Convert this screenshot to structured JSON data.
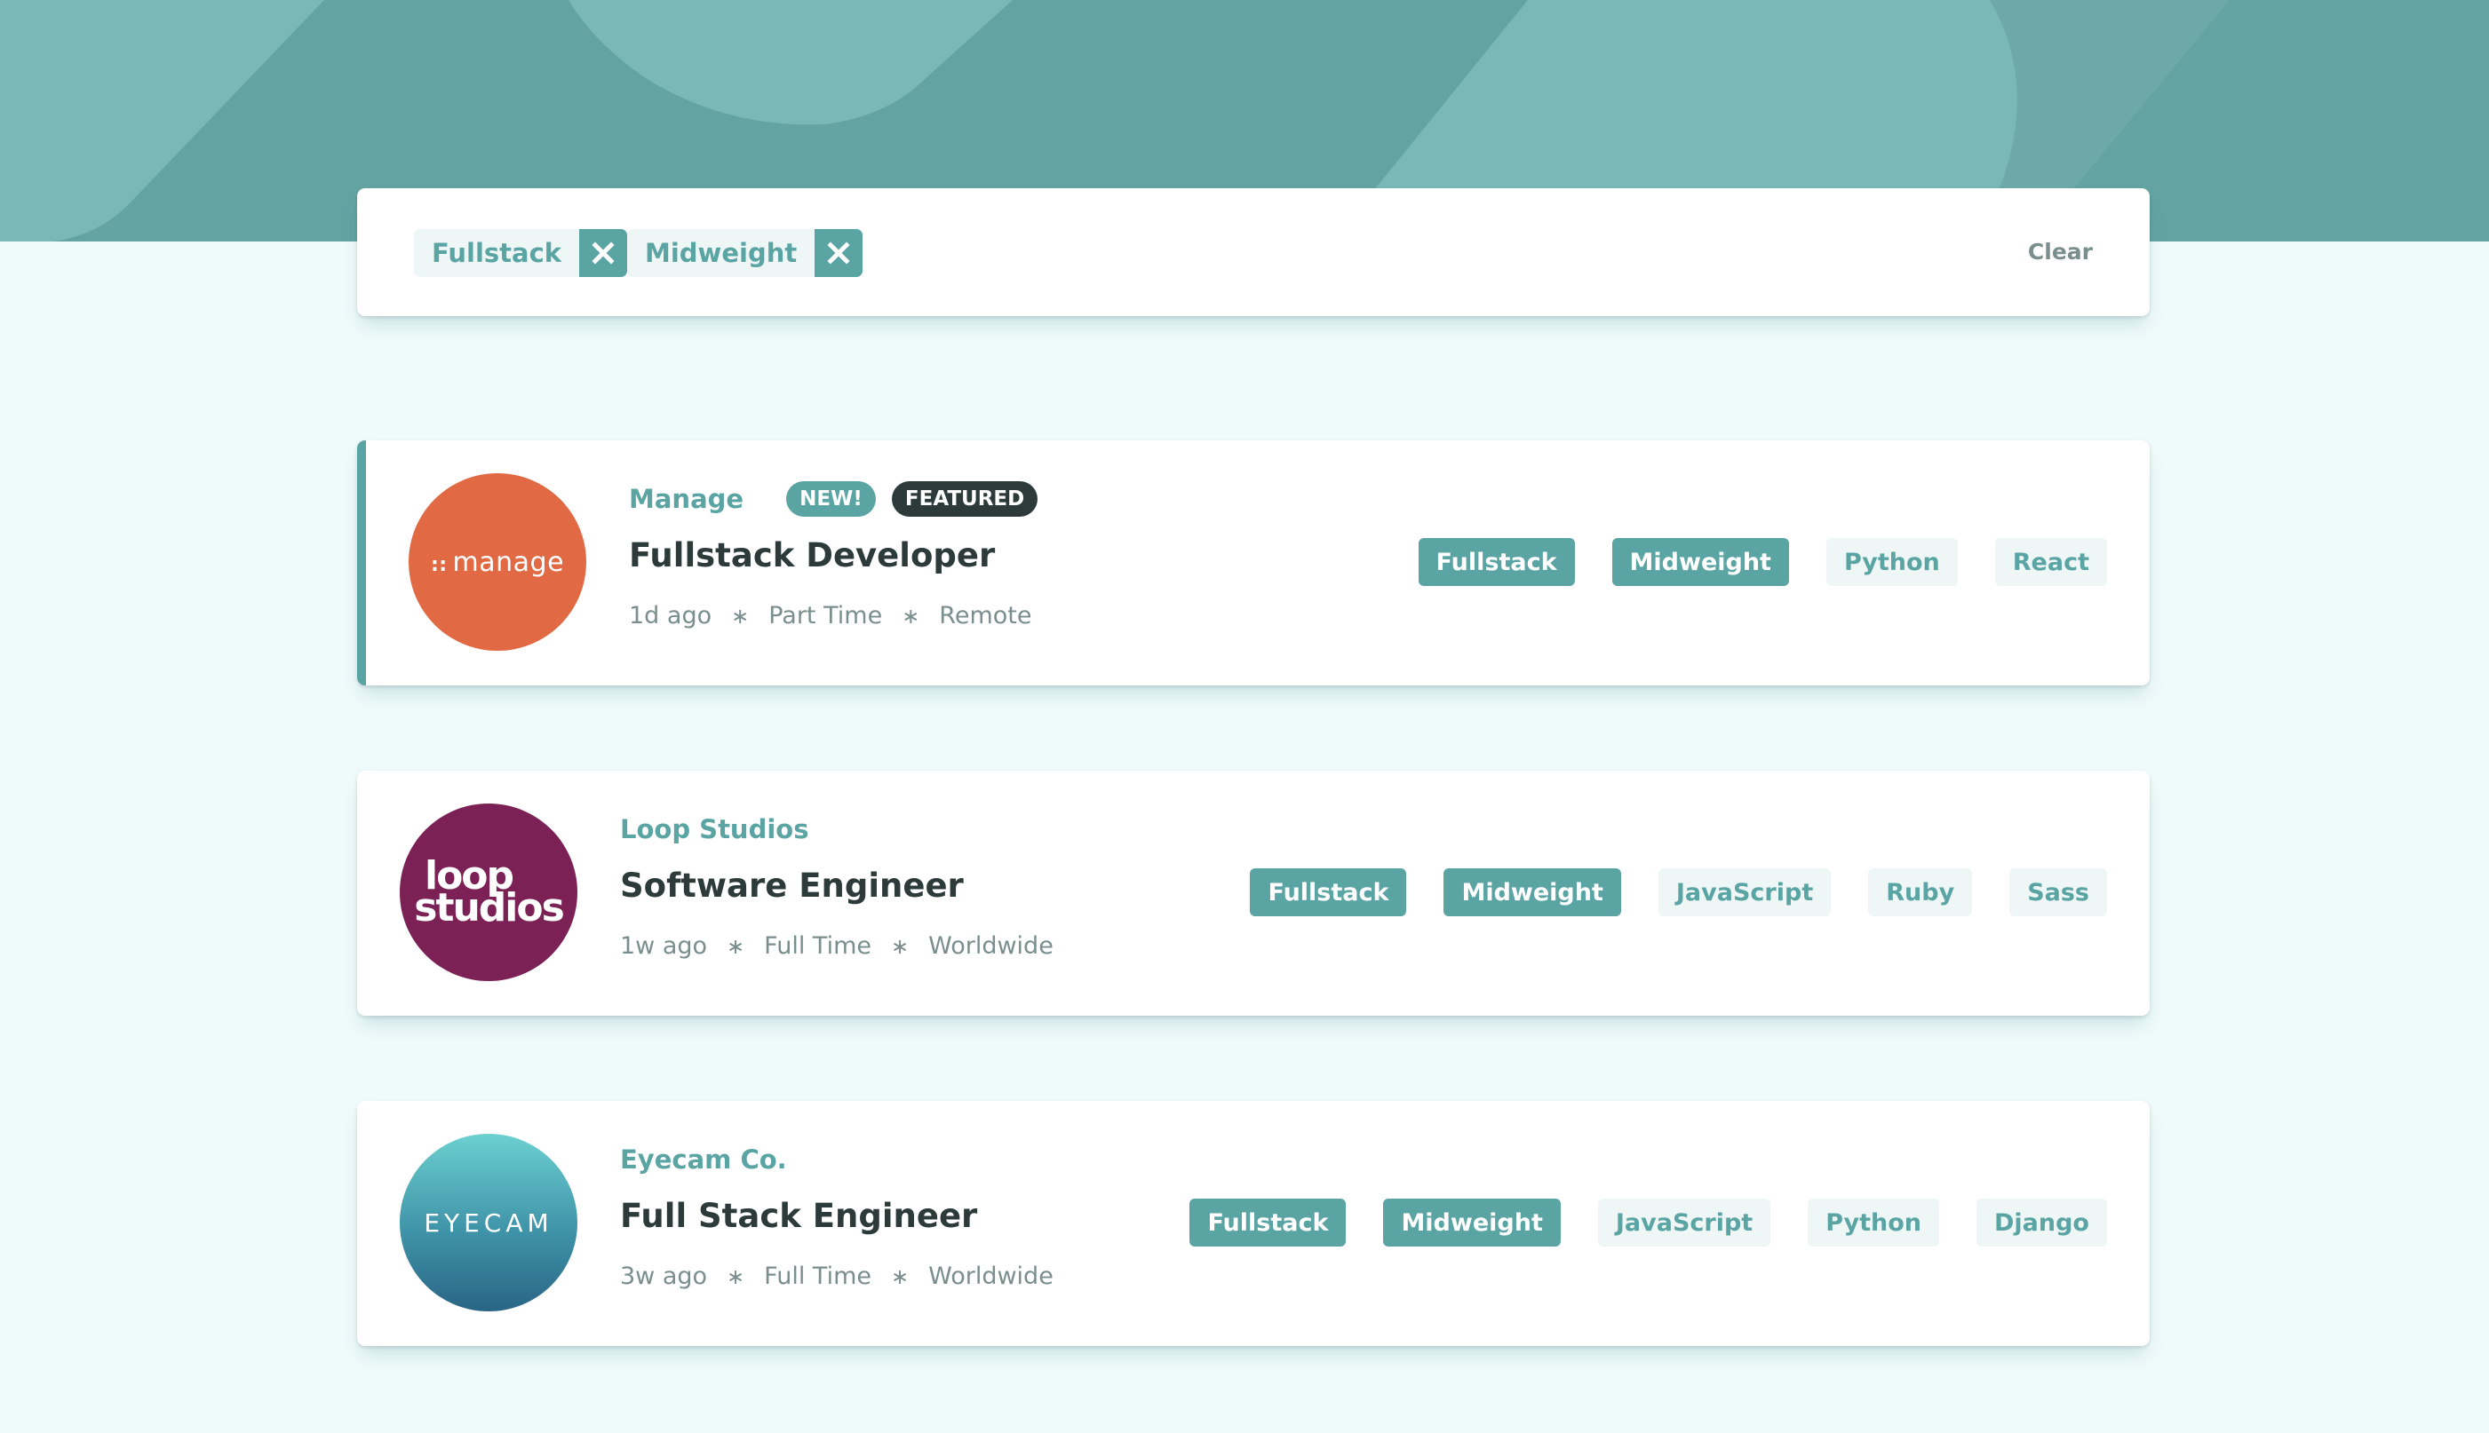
{
  "colors": {
    "primary": "#5ba4a4",
    "background": "#effafa",
    "tag_background": "#eef6f6",
    "dark": "#2c3a3a",
    "gray": "#7b8e8e"
  },
  "filters": {
    "chips": [
      {
        "label": "Fullstack",
        "icon": "close-icon"
      },
      {
        "label": "Midweight",
        "icon": "close-icon"
      }
    ],
    "clear_label": "Clear"
  },
  "jobs": [
    {
      "logo_text": "manage",
      "logo_prefix": "::",
      "company": "Manage",
      "new_label": "NEW!",
      "featured_label": "FEATURED",
      "position": "Fullstack Developer",
      "posted": "1d ago",
      "contract": "Part Time",
      "location": "Remote",
      "tags": [
        "Fullstack",
        "Midweight",
        "Python",
        "React"
      ]
    },
    {
      "logo_line1": "loop",
      "logo_line2": "studios",
      "company": "Loop Studios",
      "position": "Software Engineer",
      "posted": "1w ago",
      "contract": "Full Time",
      "location": "Worldwide",
      "tags": [
        "Fullstack",
        "Midweight",
        "JavaScript",
        "Ruby",
        "Sass"
      ]
    },
    {
      "logo_text": "EYECAM",
      "company": "Eyecam Co.",
      "position": "Full Stack Engineer",
      "posted": "3w ago",
      "contract": "Full Time",
      "location": "Worldwide",
      "tags": [
        "Fullstack",
        "Midweight",
        "JavaScript",
        "Python",
        "Django"
      ]
    }
  ],
  "separator": "∗"
}
